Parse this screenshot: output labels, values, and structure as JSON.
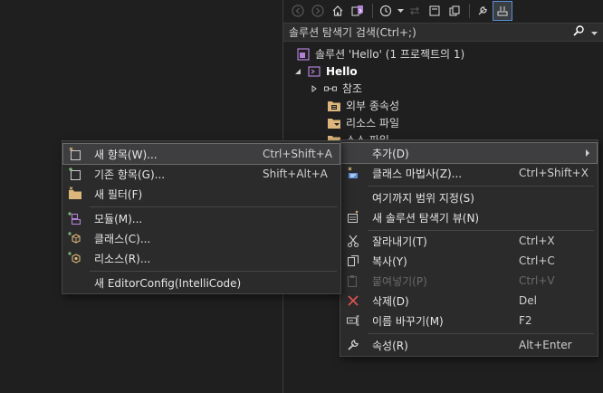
{
  "solution_explorer": {
    "search_placeholder": "솔루션 탐색기 검색(Ctrl+;)",
    "tree": {
      "solution_label": "솔루션 'Hello' (1 프로젝트의 1)",
      "project_label": "Hello",
      "references_label": "참조",
      "external_deps_label": "외부 종속성",
      "resource_files_label": "리소스 파일",
      "source_files_label": "소스 파일"
    }
  },
  "context_menu": {
    "items": [
      {
        "label": "추가(D)",
        "shortcut": ""
      },
      {
        "label": "클래스 마법사(Z)...",
        "shortcut": "Ctrl+Shift+X"
      },
      {
        "label": "여기까지 범위 지정(S)",
        "shortcut": ""
      },
      {
        "label": "새 솔루션 탐색기 뷰(N)",
        "shortcut": ""
      },
      {
        "label": "잘라내기(T)",
        "shortcut": "Ctrl+X"
      },
      {
        "label": "복사(Y)",
        "shortcut": "Ctrl+C"
      },
      {
        "label": "붙여넣기(P)",
        "shortcut": "Ctrl+V"
      },
      {
        "label": "삭제(D)",
        "shortcut": "Del"
      },
      {
        "label": "이름 바꾸기(M)",
        "shortcut": "F2"
      },
      {
        "label": "속성(R)",
        "shortcut": "Alt+Enter"
      }
    ]
  },
  "add_submenu": {
    "items": [
      {
        "label": "새 항목(W)...",
        "shortcut": "Ctrl+Shift+A"
      },
      {
        "label": "기존 항목(G)...",
        "shortcut": "Shift+Alt+A"
      },
      {
        "label": "새 필터(F)",
        "shortcut": ""
      },
      {
        "label": "모듈(M)...",
        "shortcut": ""
      },
      {
        "label": "클래스(C)...",
        "shortcut": ""
      },
      {
        "label": "리소스(R)...",
        "shortcut": ""
      },
      {
        "label": "새 EditorConfig(IntelliCode)",
        "shortcut": ""
      }
    ]
  },
  "colors": {
    "background": "#1f1f1f",
    "menu_bg": "#2b2b2b",
    "hover_bg": "#3e3e40",
    "accent_blue": "#5b8fd6",
    "folder_yellow": "#dcb67a",
    "vc_purple": "#b180d7",
    "delete_red": "#e05252",
    "add_green": "#89d185"
  }
}
